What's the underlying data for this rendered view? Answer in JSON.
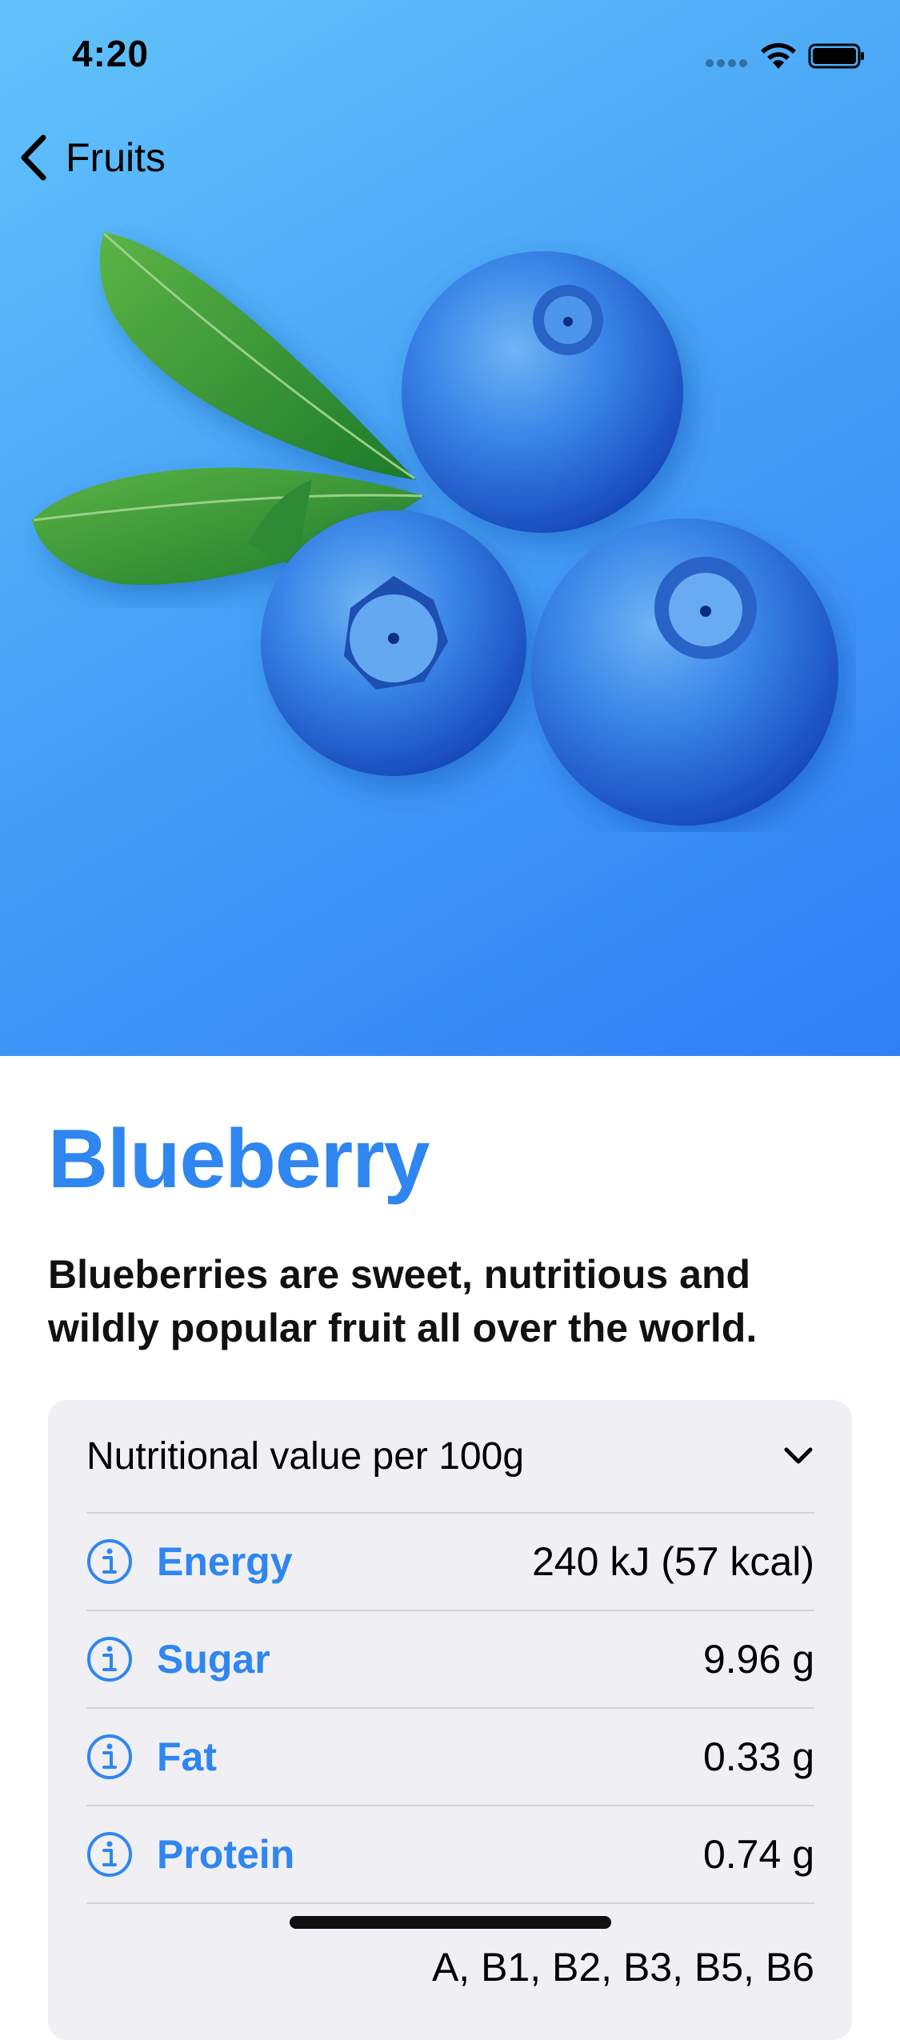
{
  "status_bar": {
    "time": "4:20"
  },
  "nav": {
    "back_label": "Fruits",
    "back_icon": "chevron-left-icon"
  },
  "fruit": {
    "title": "Blueberry",
    "headline": "Blueberries are sweet, nutritious and wildly popular fruit all over the world.",
    "image": "blueberry-illustration",
    "gradient_colors": [
      "#62c3fb",
      "#2f7ff6"
    ],
    "accent_color": "#2f86f0"
  },
  "nutrition": {
    "header": "Nutritional value per 100g",
    "expand_icon": "chevron-down-icon",
    "rows": [
      {
        "name": "Energy",
        "value": "240 kJ (57 kcal)",
        "icon": "info-icon"
      },
      {
        "name": "Sugar",
        "value": "9.96 g",
        "icon": "info-icon"
      },
      {
        "name": "Fat",
        "value": "0.33 g",
        "icon": "info-icon"
      },
      {
        "name": "Protein",
        "value": "0.74 g",
        "icon": "info-icon"
      }
    ],
    "partial_row_value": "A, B1, B2, B3, B5, B6"
  }
}
